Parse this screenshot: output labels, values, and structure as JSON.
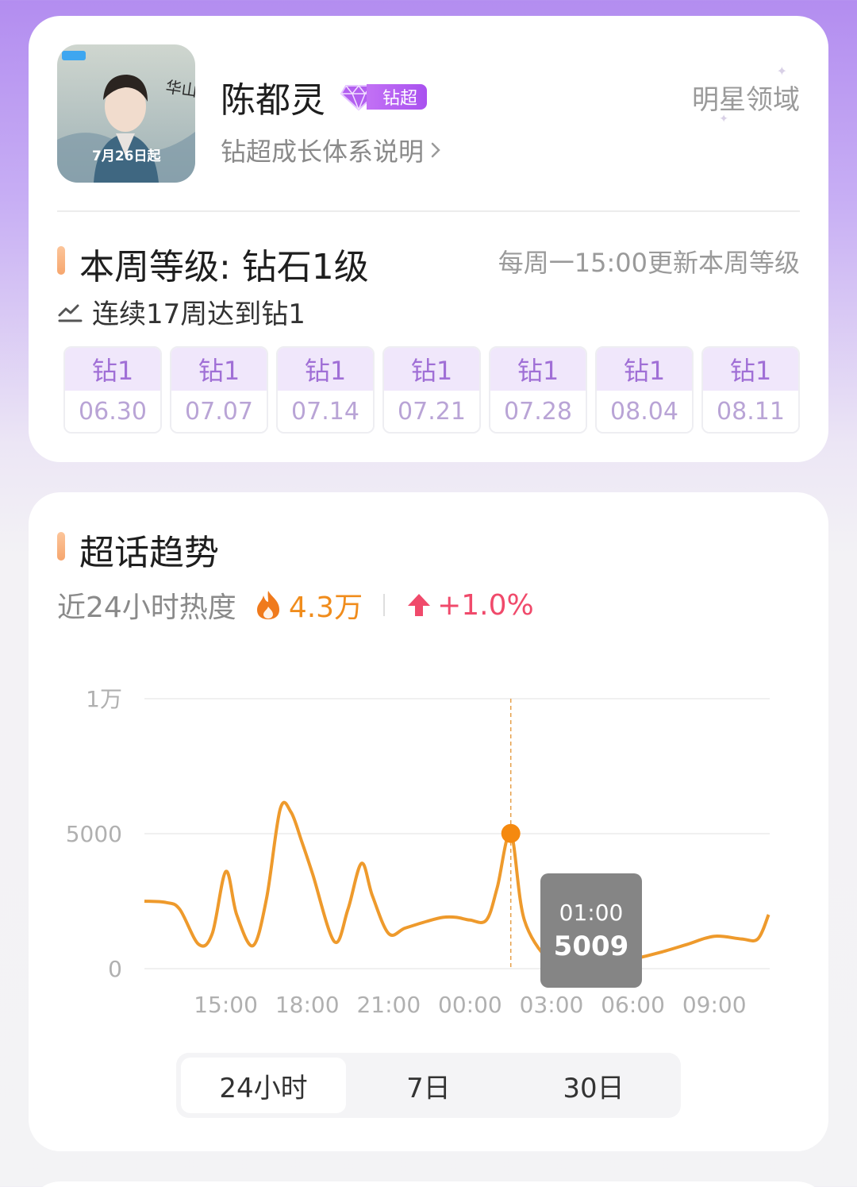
{
  "profile": {
    "name": "陈都灵",
    "badge_label": "钻超",
    "growth_link": "钻超成长体系说明",
    "domain_label": "明星领域",
    "avatar": {
      "title": "华山论剑",
      "date": "7月26日起"
    }
  },
  "level": {
    "title": "本周等级: 钻石1级",
    "update_note": "每周一15:00更新本周等级",
    "streak": "连续17周达到钻1",
    "weeks": [
      {
        "level": "钻1",
        "date": "06.30"
      },
      {
        "level": "钻1",
        "date": "07.07"
      },
      {
        "level": "钻1",
        "date": "07.14"
      },
      {
        "level": "钻1",
        "date": "07.21"
      },
      {
        "level": "钻1",
        "date": "07.28"
      },
      {
        "level": "钻1",
        "date": "08.04"
      },
      {
        "level": "钻1",
        "date": "08.11"
      }
    ]
  },
  "trend": {
    "title": "超话趋势",
    "heat_label": "近24小时热度",
    "heat_value": "4.3万",
    "heat_change": "+1.0%",
    "tabs": [
      "24小时",
      "7日",
      "30日"
    ],
    "active_tab": "24小时",
    "tooltip": {
      "time": "01:00",
      "value": "5009"
    }
  },
  "colors": {
    "accent_orange": "#f08c1c",
    "change_red": "#f04a6b",
    "line": "#ee9a2c",
    "level_purple": "#a06fd6"
  },
  "chart_data": {
    "type": "line",
    "title": "",
    "xlabel": "",
    "ylabel": "",
    "ylim": [
      0,
      10000
    ],
    "y_ticks": [
      0,
      5000,
      10000
    ],
    "y_tick_labels": [
      "0",
      "5000",
      "1万"
    ],
    "x_tick_labels": [
      "15:00",
      "18:00",
      "21:00",
      "00:00",
      "03:00",
      "06:00",
      "09:00"
    ],
    "x_tick_hours": [
      3,
      6,
      9,
      12,
      15,
      18,
      21
    ],
    "grid": true,
    "series": [
      {
        "hours": [
          0,
          0.8,
          1.3,
          2.0,
          2.5,
          3.0,
          3.4,
          4.0,
          4.5,
          5.0,
          5.4,
          5.8,
          6.2,
          7.0,
          7.5,
          8.0,
          8.4,
          9.0,
          9.6,
          10.4,
          11.0,
          11.5,
          12.0,
          12.6,
          13.0,
          13.5,
          14.0,
          15.0,
          15.6,
          16.2,
          17.0,
          18.0,
          19.0,
          20.0,
          21.0,
          22.0,
          22.6,
          23.0
        ],
        "values": [
          2500,
          2450,
          2200,
          900,
          1300,
          3600,
          2000,
          850,
          2600,
          5900,
          5800,
          4700,
          3500,
          1000,
          2200,
          3900,
          2700,
          1300,
          1500,
          1750,
          1900,
          1900,
          1800,
          1800,
          3000,
          5009,
          1800,
          200,
          200,
          150,
          150,
          350,
          600,
          900,
          1200,
          1100,
          1100,
          2000
        ]
      }
    ],
    "highlight": {
      "x": "01:00",
      "hour": 13.5,
      "value": 5009
    }
  }
}
